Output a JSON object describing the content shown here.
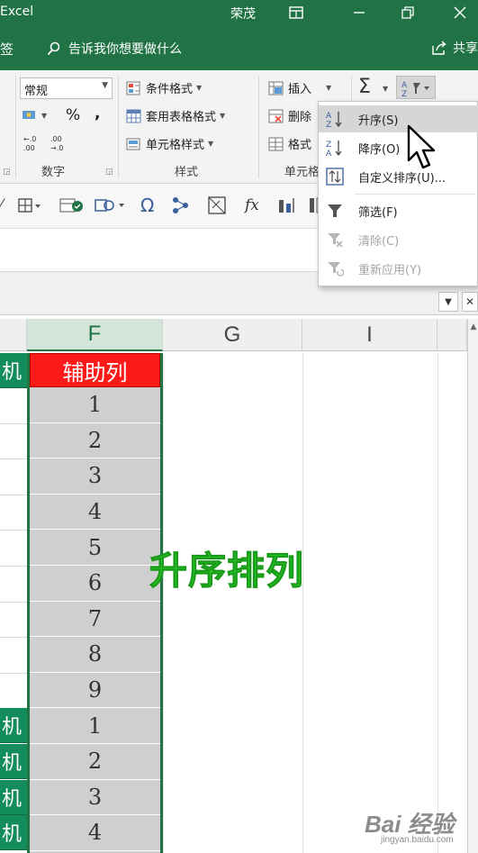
{
  "title_bar": {
    "app_title": "Excel",
    "user": "荣茂"
  },
  "tell_bar": {
    "tab_cut": "签",
    "search_text": "告诉我你想要做什么",
    "share_text": "共享"
  },
  "ribbon": {
    "number_format": "常规",
    "percent_symbol": "%",
    "comma_symbol": ",",
    "number_group_label": "数字",
    "styles": {
      "conditional_format": "条件格式",
      "format_as_table": "套用表格格式",
      "cell_styles": "单元格样式",
      "group_label": "样式"
    },
    "cells": {
      "insert": "插入",
      "delete": "删除",
      "format": "格式",
      "group_label": "单元格"
    },
    "sigma": "Σ"
  },
  "sort_menu": {
    "items": [
      {
        "label": "升序(S)",
        "icon": "sort-ascending-icon",
        "state": "hover"
      },
      {
        "label": "降序(O)",
        "icon": "sort-descending-icon",
        "state": "normal"
      },
      {
        "label": "自定义排序(U)...",
        "icon": "custom-sort-icon",
        "state": "normal"
      },
      {
        "label": "筛选(F)",
        "icon": "filter-icon",
        "state": "normal"
      },
      {
        "label": "清除(C)",
        "icon": "clear-filter-icon",
        "state": "disabled"
      },
      {
        "label": "重新应用(Y)",
        "icon": "reapply-icon",
        "state": "disabled"
      }
    ]
  },
  "qat": {
    "omega": "Ω",
    "fx": "fx"
  },
  "columns": {
    "f": "F",
    "g": "G",
    "i": "I"
  },
  "sheet": {
    "f_header": "辅助列",
    "f_values": [
      "1",
      "2",
      "3",
      "4",
      "5",
      "6",
      "7",
      "8",
      "9",
      "1",
      "2",
      "3",
      "4"
    ],
    "e_partial_text": "机",
    "e_highlight_rows": [
      0,
      10,
      11,
      12,
      13
    ]
  },
  "overlay_caption": "升序排列",
  "watermark": {
    "main": "Bai 经验",
    "sub": "jingyan.baidu.com"
  },
  "colors": {
    "excel_green": "#217346",
    "header_red": "#ff1a1a",
    "caption_green": "#2bd22b",
    "selected_column_gray": "#cfcfcf"
  }
}
